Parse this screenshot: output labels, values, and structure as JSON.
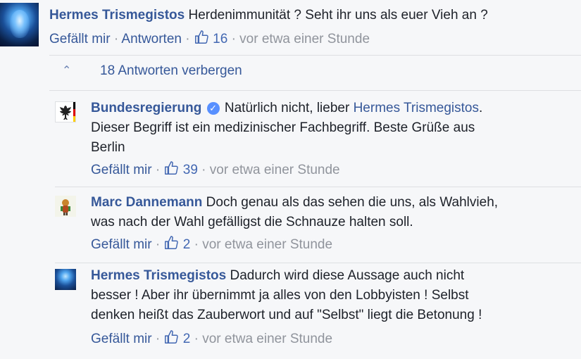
{
  "top_comment": {
    "author": "Hermes Trismegistos",
    "text": "Herdenimmunität ? Seht ihr uns als euer Vieh an ?",
    "like_label": "Gefällt mir",
    "reply_label": "Antworten",
    "like_count": "16",
    "timestamp": "vor etwa einer Stunde"
  },
  "replies_toggle": {
    "label": "18 Antworten verbergen"
  },
  "replies": [
    {
      "author": "Bundesregierung",
      "verified": true,
      "line1_text": "Natürlich nicht, lieber ",
      "mention": "Hermes Trismegistos",
      "line1_end": ".",
      "line2": "Dieser Begriff ist ein medizinischer Fachbegriff. Beste Grüße aus",
      "line3": "Berlin",
      "like_label": "Gefällt mir",
      "like_count": "39",
      "timestamp": "vor etwa einer Stunde"
    },
    {
      "author": "Marc Dannemann",
      "line1_text": "Doch genau als das sehen die uns, als Wahlvieh,",
      "line2": "was nach der Wahl gefälligst die Schnauze halten soll.",
      "like_label": "Gefällt mir",
      "like_count": "2",
      "timestamp": "vor etwa einer Stunde"
    },
    {
      "author": "Hermes Trismegistos",
      "line1_text": "Dadurch wird diese Aussage auch nicht",
      "line2": "besser ! Aber ihr übernimmt ja alles von den Lobbyisten ! Selbst",
      "line3": "denken heißt das Zauberwort und auf \"Selbst\" liegt die Betonung !",
      "like_label": "Gefällt mir",
      "like_count": "2",
      "timestamp": "vor etwa einer Stunde"
    }
  ],
  "separator": "·",
  "colors": {
    "link": "#365899",
    "muted": "#90949c",
    "like": "#4267b2",
    "verified": "#5890ff"
  }
}
